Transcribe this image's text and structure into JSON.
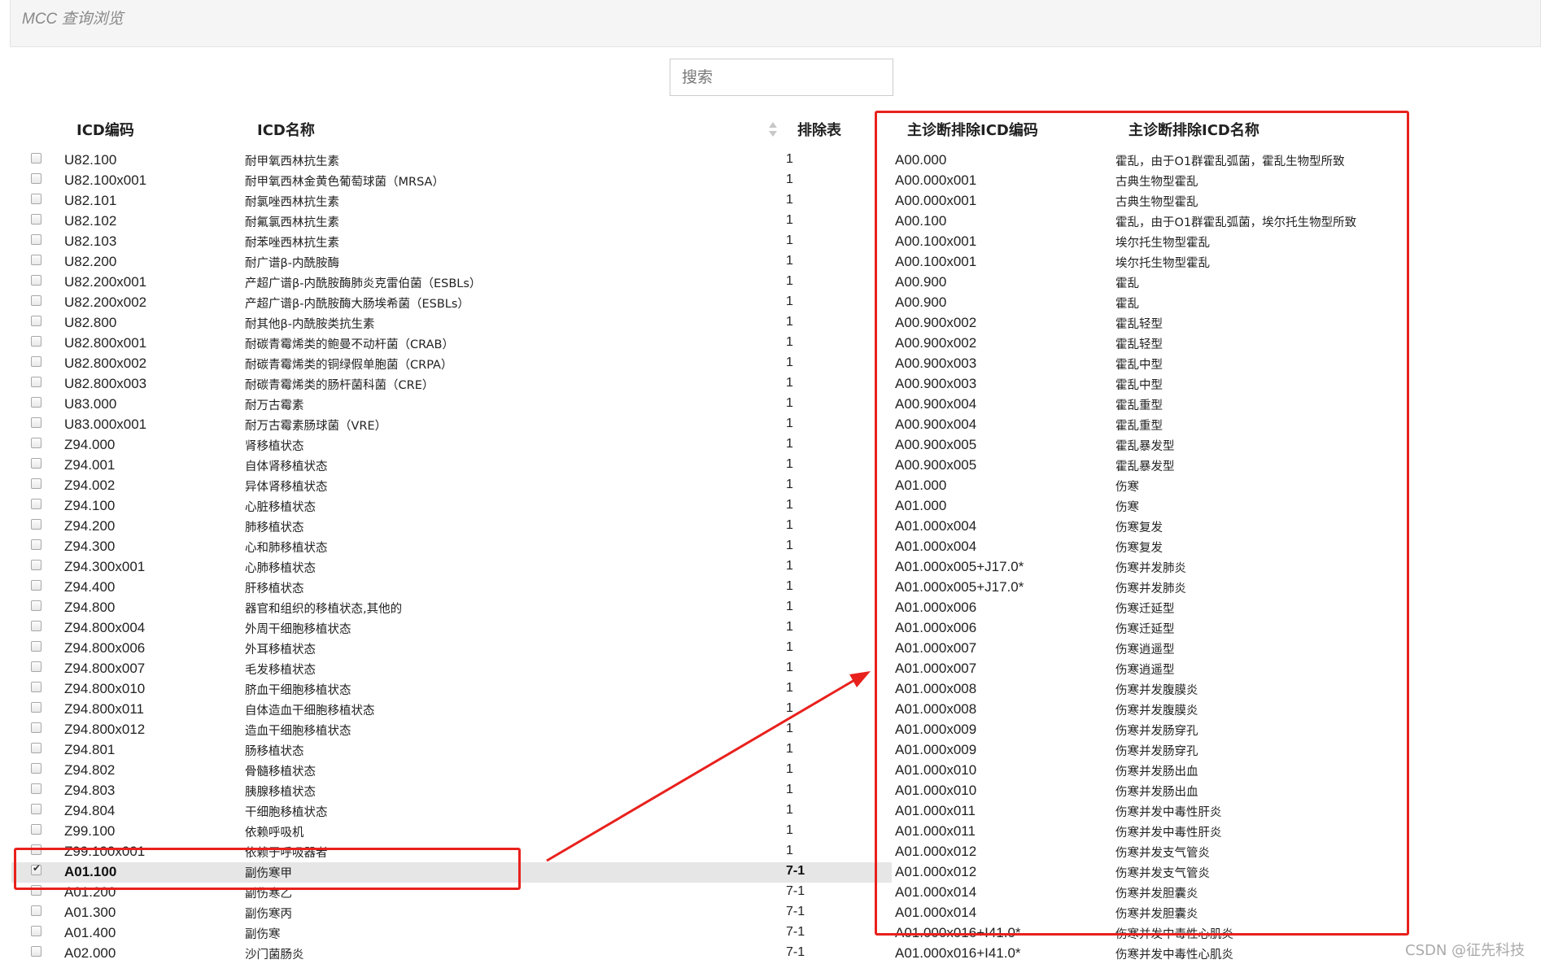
{
  "page": {
    "title": "MCC 查询浏览"
  },
  "search": {
    "placeholder": "搜索"
  },
  "columns": {
    "icd_code": "ICD编码",
    "icd_name": "ICD名称",
    "exclusion_table": "排除表",
    "excluded_code": "主诊断排除ICD编码",
    "excluded_name": "主诊断排除ICD名称"
  },
  "rows": [
    {
      "code": "U82.100",
      "name": "耐甲氧西林抗生素",
      "table": "1",
      "xcode": "A00.000",
      "xname": "霍乱，由于O1群霍乱弧菌，霍乱生物型所致",
      "checked": false
    },
    {
      "code": "U82.100x001",
      "name": "耐甲氧西林金黄色葡萄球菌（MRSA）",
      "table": "1",
      "xcode": "A00.000x001",
      "xname": "古典生物型霍乱",
      "checked": false
    },
    {
      "code": "U82.101",
      "name": "耐氯唑西林抗生素",
      "table": "1",
      "xcode": "A00.000x001",
      "xname": "古典生物型霍乱",
      "checked": false
    },
    {
      "code": "U82.102",
      "name": "耐氟氯西林抗生素",
      "table": "1",
      "xcode": "A00.100",
      "xname": "霍乱，由于O1群霍乱弧菌，埃尔托生物型所致",
      "checked": false
    },
    {
      "code": "U82.103",
      "name": "耐苯唑西林抗生素",
      "table": "1",
      "xcode": "A00.100x001",
      "xname": "埃尔托生物型霍乱",
      "checked": false
    },
    {
      "code": "U82.200",
      "name": "耐广谱β-内酰胺酶",
      "table": "1",
      "xcode": "A00.100x001",
      "xname": "埃尔托生物型霍乱",
      "checked": false
    },
    {
      "code": "U82.200x001",
      "name": "产超广谱β-内酰胺酶肺炎克雷伯菌（ESBLs）",
      "table": "1",
      "xcode": "A00.900",
      "xname": "霍乱",
      "checked": false
    },
    {
      "code": "U82.200x002",
      "name": "产超广谱β-内酰胺酶大肠埃希菌（ESBLs）",
      "table": "1",
      "xcode": "A00.900",
      "xname": "霍乱",
      "checked": false
    },
    {
      "code": "U82.800",
      "name": "耐其他β-内酰胺类抗生素",
      "table": "1",
      "xcode": "A00.900x002",
      "xname": "霍乱轻型",
      "checked": false
    },
    {
      "code": "U82.800x001",
      "name": "耐碳青霉烯类的鲍曼不动杆菌（CRAB）",
      "table": "1",
      "xcode": "A00.900x002",
      "xname": "霍乱轻型",
      "checked": false
    },
    {
      "code": "U82.800x002",
      "name": "耐碳青霉烯类的铜绿假单胞菌（CRPA）",
      "table": "1",
      "xcode": "A00.900x003",
      "xname": "霍乱中型",
      "checked": false
    },
    {
      "code": "U82.800x003",
      "name": "耐碳青霉烯类的肠杆菌科菌（CRE）",
      "table": "1",
      "xcode": "A00.900x003",
      "xname": "霍乱中型",
      "checked": false
    },
    {
      "code": "U83.000",
      "name": "耐万古霉素",
      "table": "1",
      "xcode": "A00.900x004",
      "xname": "霍乱重型",
      "checked": false
    },
    {
      "code": "U83.000x001",
      "name": "耐万古霉素肠球菌（VRE）",
      "table": "1",
      "xcode": "A00.900x004",
      "xname": "霍乱重型",
      "checked": false
    },
    {
      "code": "Z94.000",
      "name": "肾移植状态",
      "table": "1",
      "xcode": "A00.900x005",
      "xname": "霍乱暴发型",
      "checked": false
    },
    {
      "code": "Z94.001",
      "name": "自体肾移植状态",
      "table": "1",
      "xcode": "A00.900x005",
      "xname": "霍乱暴发型",
      "checked": false
    },
    {
      "code": "Z94.002",
      "name": "异体肾移植状态",
      "table": "1",
      "xcode": "A01.000",
      "xname": "伤寒",
      "checked": false
    },
    {
      "code": "Z94.100",
      "name": "心脏移植状态",
      "table": "1",
      "xcode": "A01.000",
      "xname": "伤寒",
      "checked": false
    },
    {
      "code": "Z94.200",
      "name": "肺移植状态",
      "table": "1",
      "xcode": "A01.000x004",
      "xname": "伤寒复发",
      "checked": false
    },
    {
      "code": "Z94.300",
      "name": "心和肺移植状态",
      "table": "1",
      "xcode": "A01.000x004",
      "xname": "伤寒复发",
      "checked": false
    },
    {
      "code": "Z94.300x001",
      "name": "心肺移植状态",
      "table": "1",
      "xcode": "A01.000x005+J17.0*",
      "xname": "伤寒并发肺炎",
      "checked": false
    },
    {
      "code": "Z94.400",
      "name": "肝移植状态",
      "table": "1",
      "xcode": "A01.000x005+J17.0*",
      "xname": "伤寒并发肺炎",
      "checked": false
    },
    {
      "code": "Z94.800",
      "name": "器官和组织的移植状态,其他的",
      "table": "1",
      "xcode": "A01.000x006",
      "xname": "伤寒迁延型",
      "checked": false
    },
    {
      "code": "Z94.800x004",
      "name": "外周干细胞移植状态",
      "table": "1",
      "xcode": "A01.000x006",
      "xname": "伤寒迁延型",
      "checked": false
    },
    {
      "code": "Z94.800x006",
      "name": "外耳移植状态",
      "table": "1",
      "xcode": "A01.000x007",
      "xname": "伤寒逍遥型",
      "checked": false
    },
    {
      "code": "Z94.800x007",
      "name": "毛发移植状态",
      "table": "1",
      "xcode": "A01.000x007",
      "xname": "伤寒逍遥型",
      "checked": false
    },
    {
      "code": "Z94.800x010",
      "name": "脐血干细胞移植状态",
      "table": "1",
      "xcode": "A01.000x008",
      "xname": "伤寒并发腹膜炎",
      "checked": false
    },
    {
      "code": "Z94.800x011",
      "name": "自体造血干细胞移植状态",
      "table": "1",
      "xcode": "A01.000x008",
      "xname": "伤寒并发腹膜炎",
      "checked": false
    },
    {
      "code": "Z94.800x012",
      "name": "造血干细胞移植状态",
      "table": "1",
      "xcode": "A01.000x009",
      "xname": "伤寒并发肠穿孔",
      "checked": false
    },
    {
      "code": "Z94.801",
      "name": "肠移植状态",
      "table": "1",
      "xcode": "A01.000x009",
      "xname": "伤寒并发肠穿孔",
      "checked": false
    },
    {
      "code": "Z94.802",
      "name": "骨髓移植状态",
      "table": "1",
      "xcode": "A01.000x010",
      "xname": "伤寒并发肠出血",
      "checked": false
    },
    {
      "code": "Z94.803",
      "name": "胰腺移植状态",
      "table": "1",
      "xcode": "A01.000x010",
      "xname": "伤寒并发肠出血",
      "checked": false
    },
    {
      "code": "Z94.804",
      "name": "干细胞移植状态",
      "table": "1",
      "xcode": "A01.000x011",
      "xname": "伤寒并发中毒性肝炎",
      "checked": false
    },
    {
      "code": "Z99.100",
      "name": "依赖呼吸机",
      "table": "1",
      "xcode": "A01.000x011",
      "xname": "伤寒并发中毒性肝炎",
      "checked": false
    },
    {
      "code": "Z99.100x001",
      "name": "依赖于呼吸器者",
      "table": "1",
      "xcode": "A01.000x012",
      "xname": "伤寒并发支气管炎",
      "checked": false
    },
    {
      "code": "A01.100",
      "name": "副伤寒甲",
      "table": "7-1",
      "xcode": "A01.000x012",
      "xname": "伤寒并发支气管炎",
      "checked": true
    },
    {
      "code": "A01.200",
      "name": "副伤寒乙",
      "table": "7-1",
      "xcode": "A01.000x014",
      "xname": "伤寒并发胆囊炎",
      "checked": false
    },
    {
      "code": "A01.300",
      "name": "副伤寒丙",
      "table": "7-1",
      "xcode": "A01.000x014",
      "xname": "伤寒并发胆囊炎",
      "checked": false
    },
    {
      "code": "A01.400",
      "name": "副伤寒",
      "table": "7-1",
      "xcode": "A01.000x016+I41.0*",
      "xname": "伤寒并发中毒性心肌炎",
      "checked": false
    },
    {
      "code": "A02.000",
      "name": "沙门菌肠炎",
      "table": "7-1",
      "xcode": "A01.000x016+I41.0*",
      "xname": "伤寒并发中毒性心肌炎",
      "checked": false
    }
  ],
  "annotations": {
    "color": "#e8211d"
  },
  "watermark": "CSDN @征先科技"
}
